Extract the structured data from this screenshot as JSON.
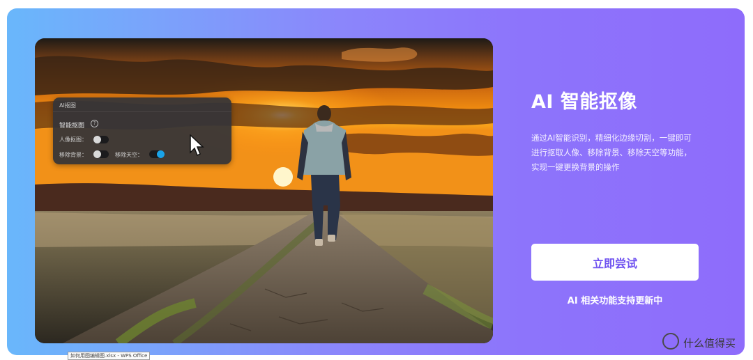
{
  "feature": {
    "title": "AI 智能抠像",
    "description": "通过AI智能识别，精细化边缘切割，一键即可进行抠取人像、移除背景、移除天空等功能，实现一键更换背景的操作",
    "try_button": "立即尝试",
    "update_note": "AI 相关功能支持更新中"
  },
  "ai_panel": {
    "title": "AI抠图",
    "smart_label": "智能抠图",
    "help_icon": "?",
    "options": [
      {
        "label": "人像抠图：",
        "state": "off"
      },
      {
        "label": "移除背景：",
        "state": "off"
      },
      {
        "label": "移除天空：",
        "state": "on"
      }
    ]
  },
  "taskbar_tooltip": "如何用图编辑图.xlsx - WPS Office",
  "watermark": "什么值得买",
  "colors": {
    "card_gradient_start": "#69b7fb",
    "card_gradient_end": "#8e6cfb",
    "button_text": "#6f52f0",
    "toggle_on": "#1aa3e8"
  },
  "icons": {
    "cursor": "mouse-pointer-icon",
    "help": "question-circle-icon",
    "watermark": "smzdm-logo-icon"
  }
}
